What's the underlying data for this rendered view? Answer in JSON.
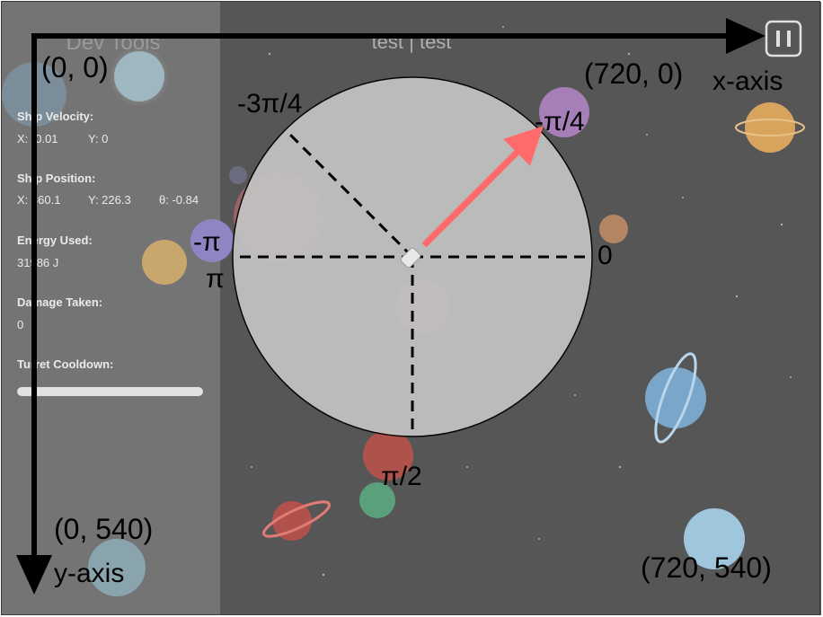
{
  "game": {
    "title": "test | test",
    "pause_icon": "pause-icon"
  },
  "dev_tools": {
    "heading": "Dev Tools",
    "ship_velocity": {
      "label": "Ship Velocity:",
      "x": "X: -0.01",
      "y": "Y: 0"
    },
    "ship_position": {
      "label": "Ship Position:",
      "x": "X: 360.1",
      "y": "Y: 226.3",
      "theta": "θ: -0.84"
    },
    "energy_used": {
      "label": "Energy Used:",
      "value": "31986 J"
    },
    "damage_taken": {
      "label": "Damage Taken:",
      "value": "0"
    },
    "turret_cooldown": {
      "label": "Turret Cooldown:",
      "level": 1.0
    }
  },
  "annotations": {
    "origin": "(0, 0)",
    "top_right": "(720, 0)",
    "bottom_left": "(0, 540)",
    "bottom_right": "(720, 540)",
    "x_axis": "x-axis",
    "y_axis": "y-axis",
    "angles": {
      "neg_3pi_4": "-3π/4",
      "neg_pi_4": "-π/4",
      "neg_pi": "-π",
      "pi": "π",
      "zero": "0",
      "pi_2": "π/2"
    },
    "colors": {
      "arrow": "#ff6b6b",
      "axis": "#000000",
      "circle_fill": "#c4c4c4",
      "background": "#565656",
      "sidebar": "#747474"
    }
  }
}
